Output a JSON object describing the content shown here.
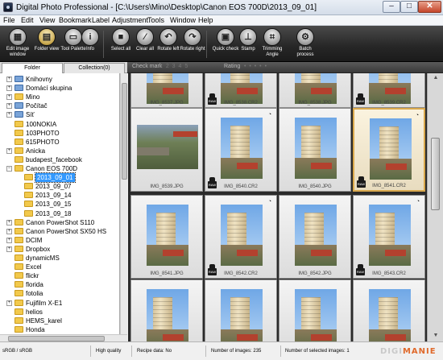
{
  "window": {
    "title": "Digital Photo Professional - [C:\\Users\\Mino\\Desktop\\Canon EOS 700D\\2013_09_01]",
    "min_glyph": "–",
    "max_glyph": "□",
    "close_glyph": "✕"
  },
  "menu": [
    "File",
    "Edit",
    "View",
    "Bookmark",
    "Label",
    "Adjustment",
    "Tools",
    "Window",
    "Help"
  ],
  "toolbar": [
    {
      "label": "Edit image window",
      "icon": "edit-image-icon",
      "glyph": "▦"
    },
    {
      "label": "Folder view",
      "icon": "folder-view-icon",
      "glyph": "▤",
      "active": true
    },
    {
      "label": "Tool Palette",
      "icon": "tool-palette-icon",
      "glyph": "▭"
    },
    {
      "label": "Info",
      "icon": "info-icon",
      "glyph": "i"
    },
    {
      "label": "Select all",
      "icon": "select-all-icon",
      "glyph": "■"
    },
    {
      "label": "Clear all",
      "icon": "clear-all-icon",
      "glyph": "⁄"
    },
    {
      "label": "Rotate left",
      "icon": "rotate-left-icon",
      "glyph": "↶"
    },
    {
      "label": "Rotate right",
      "icon": "rotate-right-icon",
      "glyph": "↷"
    },
    {
      "label": "Quick check",
      "icon": "quick-check-icon",
      "glyph": "▣"
    },
    {
      "label": "Stamp",
      "icon": "stamp-icon",
      "glyph": "⊥"
    },
    {
      "label": "Trimming Angle",
      "icon": "trimming-angle-icon",
      "glyph": "⌗"
    },
    {
      "label": "Batch process",
      "icon": "batch-process-icon",
      "glyph": "⚙"
    }
  ],
  "panel_tabs": {
    "folder": "Folder",
    "collection": "Collection(0)"
  },
  "filterbar": {
    "check_mark": "Check mark",
    "checks": "1 2 3 4 5",
    "rating": "Rating",
    "stars": "• • • • •"
  },
  "tree": [
    {
      "label": "Knihovny",
      "level": 1,
      "expander": "+",
      "special": true
    },
    {
      "label": "Domácí skupina",
      "level": 1,
      "expander": "+",
      "special": true
    },
    {
      "label": "Mino",
      "level": 1,
      "expander": "+"
    },
    {
      "label": "Počítač",
      "level": 1,
      "expander": "+",
      "special": true
    },
    {
      "label": "Síť",
      "level": 1,
      "expander": "+",
      "special": true
    },
    {
      "label": "100NOKIA",
      "level": 1
    },
    {
      "label": "103PHOTO",
      "level": 1
    },
    {
      "label": "615PHOTO",
      "level": 1
    },
    {
      "label": "Anicka",
      "level": 1,
      "expander": "+"
    },
    {
      "label": "budapest_facebook",
      "level": 1
    },
    {
      "label": "Canon EOS 700D",
      "level": 1,
      "expander": "−"
    },
    {
      "label": "2013_09_01",
      "level": 2,
      "selected": true
    },
    {
      "label": "2013_09_07",
      "level": 2
    },
    {
      "label": "2013_09_14",
      "level": 2
    },
    {
      "label": "2013_09_15",
      "level": 2
    },
    {
      "label": "2013_09_18",
      "level": 2
    },
    {
      "label": "Canon PowerShot S110",
      "level": 1,
      "expander": "+"
    },
    {
      "label": "Canon PowerShot SX50 HS",
      "level": 1,
      "expander": "+"
    },
    {
      "label": "DCIM",
      "level": 1,
      "expander": "+"
    },
    {
      "label": "Dropbox",
      "level": 1,
      "expander": "+"
    },
    {
      "label": "dynamicMS",
      "level": 1
    },
    {
      "label": "Excel",
      "level": 1
    },
    {
      "label": "flickr",
      "level": 1
    },
    {
      "label": "florida",
      "level": 1
    },
    {
      "label": "fotolia",
      "level": 1
    },
    {
      "label": "Fujifilm X-E1",
      "level": 1,
      "expander": "+"
    },
    {
      "label": "helios",
      "level": 1
    },
    {
      "label": "HEMS_karel",
      "level": 1
    },
    {
      "label": "Honda",
      "level": 1
    }
  ],
  "grid": {
    "top_row": [
      "IMG_8537.JPG",
      "IMG_8538.CR2",
      "IMG_8538.JPG",
      "IMG_8539.CR2"
    ],
    "rows": [
      [
        "IMG_8539.JPG",
        "IMG_8540.CR2",
        "IMG_8540.JPG",
        "IMG_8541.CR2"
      ],
      [
        "IMG_8541.JPG",
        "IMG_8542.CR2",
        "IMG_8542.JPG",
        "IMG_8543.CR2"
      ],
      [
        "",
        "",
        "",
        ""
      ]
    ],
    "selected": "IMG_8541.CR2",
    "raw_label": "RAW",
    "badge_glyph": "◔"
  },
  "status": {
    "color_space": "sRGB / sRGB",
    "quality": "High quality",
    "recipe": "Recipe data: No",
    "count": "Number of images: 235",
    "selected": "Number of selected images: 1"
  },
  "watermark": {
    "part1": "DIGI",
    "part2": "MANIE"
  },
  "scroll": {
    "up": "▲",
    "down": "▼"
  }
}
